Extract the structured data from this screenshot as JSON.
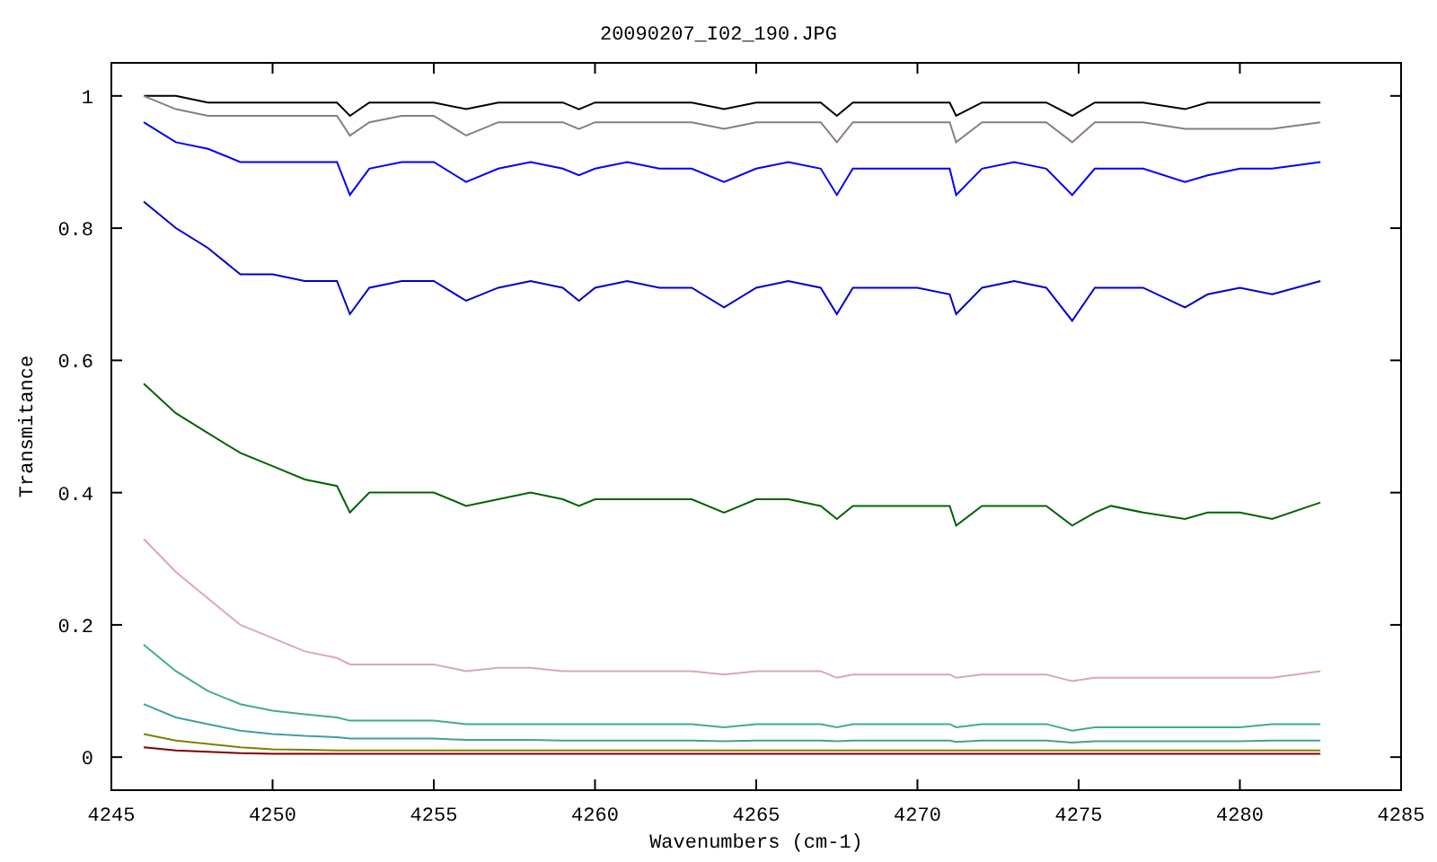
{
  "chart_data": {
    "type": "line",
    "title": "20090207_I02_190.JPG",
    "xlabel": "Wavenumbers (cm-1)",
    "ylabel": "Transmitance",
    "xlim": [
      4245,
      4285
    ],
    "ylim": [
      -0.05,
      1.05
    ],
    "xticks": [
      4245,
      4250,
      4255,
      4260,
      4265,
      4270,
      4275,
      4280,
      4285
    ],
    "yticks": [
      0,
      0.2,
      0.4,
      0.6,
      0.8,
      1
    ],
    "x": [
      4246,
      4247,
      4248,
      4249,
      4250,
      4251,
      4252,
      4252.4,
      4253,
      4254,
      4255,
      4256,
      4257,
      4258,
      4259,
      4259.5,
      4260,
      4261,
      4262,
      4263,
      4264,
      4265,
      4266,
      4267,
      4267.5,
      4268,
      4269,
      4270,
      4271,
      4271.2,
      4272,
      4273,
      4274,
      4274.8,
      4275.5,
      4276,
      4277,
      4278.3,
      4279,
      4280,
      4281,
      4282.5
    ],
    "series": [
      {
        "color": "#000000",
        "values": [
          1.0,
          1.0,
          0.99,
          0.99,
          0.99,
          0.99,
          0.99,
          0.97,
          0.99,
          0.99,
          0.99,
          0.98,
          0.99,
          0.99,
          0.99,
          0.98,
          0.99,
          0.99,
          0.99,
          0.99,
          0.98,
          0.99,
          0.99,
          0.99,
          0.97,
          0.99,
          0.99,
          0.99,
          0.99,
          0.97,
          0.99,
          0.99,
          0.99,
          0.97,
          0.99,
          0.99,
          0.99,
          0.98,
          0.99,
          0.99,
          0.99,
          0.99
        ]
      },
      {
        "color": "#8b7b8b",
        "values": [
          1.0,
          0.98,
          0.97,
          0.97,
          0.97,
          0.97,
          0.97,
          0.94,
          0.96,
          0.97,
          0.97,
          0.94,
          0.96,
          0.96,
          0.96,
          0.95,
          0.96,
          0.96,
          0.96,
          0.96,
          0.95,
          0.96,
          0.96,
          0.96,
          0.93,
          0.96,
          0.96,
          0.96,
          0.96,
          0.93,
          0.96,
          0.96,
          0.96,
          0.93,
          0.96,
          0.96,
          0.96,
          0.95,
          0.95,
          0.95,
          0.95,
          0.96
        ]
      },
      {
        "color": "#0000ff",
        "values": [
          0.96,
          0.93,
          0.92,
          0.9,
          0.9,
          0.9,
          0.9,
          0.85,
          0.89,
          0.9,
          0.9,
          0.87,
          0.89,
          0.9,
          0.89,
          0.88,
          0.89,
          0.9,
          0.89,
          0.89,
          0.87,
          0.89,
          0.9,
          0.89,
          0.85,
          0.89,
          0.89,
          0.89,
          0.89,
          0.85,
          0.89,
          0.9,
          0.89,
          0.85,
          0.89,
          0.89,
          0.89,
          0.87,
          0.88,
          0.89,
          0.89,
          0.9
        ]
      },
      {
        "color": "#0000cd",
        "values": [
          0.84,
          0.8,
          0.77,
          0.73,
          0.73,
          0.72,
          0.72,
          0.67,
          0.71,
          0.72,
          0.72,
          0.69,
          0.71,
          0.72,
          0.71,
          0.69,
          0.71,
          0.72,
          0.71,
          0.71,
          0.68,
          0.71,
          0.72,
          0.71,
          0.67,
          0.71,
          0.71,
          0.71,
          0.7,
          0.67,
          0.71,
          0.72,
          0.71,
          0.66,
          0.71,
          0.71,
          0.71,
          0.68,
          0.7,
          0.71,
          0.7,
          0.72
        ]
      },
      {
        "color": "#006400",
        "values": [
          0.565,
          0.52,
          0.49,
          0.46,
          0.44,
          0.42,
          0.41,
          0.37,
          0.4,
          0.4,
          0.4,
          0.38,
          0.39,
          0.4,
          0.39,
          0.38,
          0.39,
          0.39,
          0.39,
          0.39,
          0.37,
          0.39,
          0.39,
          0.38,
          0.36,
          0.38,
          0.38,
          0.38,
          0.38,
          0.35,
          0.38,
          0.38,
          0.38,
          0.35,
          0.37,
          0.38,
          0.37,
          0.36,
          0.37,
          0.37,
          0.36,
          0.385
        ]
      },
      {
        "color": "#d8a8b8",
        "values": [
          0.33,
          0.28,
          0.24,
          0.2,
          0.18,
          0.16,
          0.15,
          0.14,
          0.14,
          0.14,
          0.14,
          0.13,
          0.135,
          0.135,
          0.13,
          0.13,
          0.13,
          0.13,
          0.13,
          0.13,
          0.125,
          0.13,
          0.13,
          0.13,
          0.12,
          0.125,
          0.125,
          0.125,
          0.125,
          0.12,
          0.125,
          0.125,
          0.125,
          0.115,
          0.12,
          0.12,
          0.12,
          0.12,
          0.12,
          0.12,
          0.12,
          0.13
        ]
      },
      {
        "color": "#40b080",
        "values": [
          0.17,
          0.13,
          0.1,
          0.08,
          0.07,
          0.065,
          0.06,
          0.055,
          0.055,
          0.055,
          0.055,
          0.05,
          0.05,
          0.05,
          0.05,
          0.05,
          0.05,
          0.05,
          0.05,
          0.05,
          0.045,
          0.05,
          0.05,
          0.05,
          0.045,
          0.05,
          0.05,
          0.05,
          0.05,
          0.045,
          0.05,
          0.05,
          0.05,
          0.04,
          0.045,
          0.045,
          0.045,
          0.045,
          0.045,
          0.045,
          0.05,
          0.05
        ]
      },
      {
        "color": "#40a0a0",
        "values": [
          0.08,
          0.06,
          0.05,
          0.04,
          0.035,
          0.032,
          0.03,
          0.028,
          0.028,
          0.028,
          0.028,
          0.026,
          0.026,
          0.026,
          0.025,
          0.025,
          0.025,
          0.025,
          0.025,
          0.025,
          0.024,
          0.025,
          0.025,
          0.025,
          0.024,
          0.025,
          0.025,
          0.025,
          0.025,
          0.023,
          0.025,
          0.025,
          0.025,
          0.022,
          0.024,
          0.024,
          0.024,
          0.024,
          0.024,
          0.024,
          0.025,
          0.025
        ]
      },
      {
        "color": "#808000",
        "values": [
          0.035,
          0.025,
          0.02,
          0.015,
          0.012,
          0.011,
          0.01,
          0.01,
          0.01,
          0.01,
          0.01,
          0.01,
          0.01,
          0.01,
          0.01,
          0.01,
          0.01,
          0.01,
          0.01,
          0.01,
          0.01,
          0.01,
          0.01,
          0.01,
          0.01,
          0.01,
          0.01,
          0.01,
          0.01,
          0.01,
          0.01,
          0.01,
          0.01,
          0.01,
          0.01,
          0.01,
          0.01,
          0.01,
          0.01,
          0.01,
          0.01,
          0.01
        ]
      },
      {
        "color": "#800000",
        "values": [
          0.015,
          0.01,
          0.008,
          0.006,
          0.005,
          0.005,
          0.005,
          0.005,
          0.005,
          0.005,
          0.005,
          0.005,
          0.005,
          0.005,
          0.005,
          0.005,
          0.005,
          0.005,
          0.005,
          0.005,
          0.005,
          0.005,
          0.005,
          0.005,
          0.005,
          0.005,
          0.005,
          0.005,
          0.005,
          0.005,
          0.005,
          0.005,
          0.005,
          0.005,
          0.005,
          0.005,
          0.005,
          0.005,
          0.005,
          0.005,
          0.005,
          0.005
        ]
      }
    ]
  }
}
